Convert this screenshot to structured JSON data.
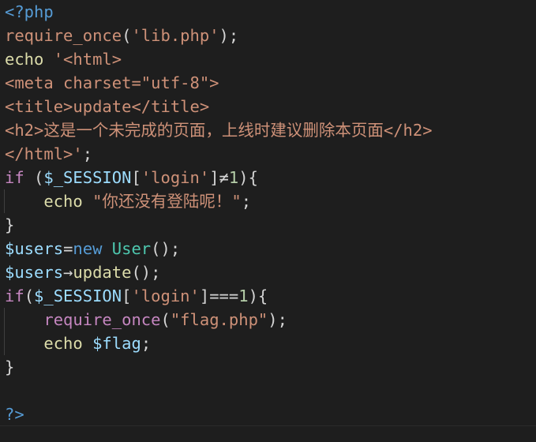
{
  "code": {
    "open_tag": "<?php",
    "l2_fn": "require_once",
    "l2_p1": "(",
    "l2_str": "'lib.php'",
    "l2_p2": ");",
    "l3_kw": "echo",
    "l3_str": " '<html>",
    "l4": "<meta charset=\"utf-8\">",
    "l5": "<title>update</title>",
    "l6": "<h2>这是一个未完成的页面，上线时建议删除本页面</h2>",
    "l7_str": "</html>'",
    "l7_end": ";",
    "l8_kw": "if",
    "l8_a": " (",
    "l8_var": "$_SESSION",
    "l8_b": "[",
    "l8_str": "'login'",
    "l8_c": "]≠",
    "l8_num": "1",
    "l8_d": "){",
    "l9_kw": "echo",
    "l9_str": "\"你还没有登陆呢！\"",
    "l9_end": ";",
    "l10": "}",
    "l11_var": "$users",
    "l11_a": "=",
    "l11_new": "new",
    "l11_cls": "User",
    "l11_b": "();",
    "l12_var": "$users",
    "l12_a": "→",
    "l12_fn": "update",
    "l12_b": "();",
    "l13_kw": "if",
    "l13_a": "(",
    "l13_var": "$_SESSION",
    "l13_b": "[",
    "l13_str": "'login'",
    "l13_c": "]===",
    "l13_num": "1",
    "l13_d": "){",
    "l14_fn": "require_once",
    "l14_a": "(",
    "l14_str": "\"flag.php\"",
    "l14_b": ");",
    "l15_kw": "echo",
    "l15_var": "$flag",
    "l15_end": ";",
    "l16": "}",
    "close_tag": "?>"
  }
}
